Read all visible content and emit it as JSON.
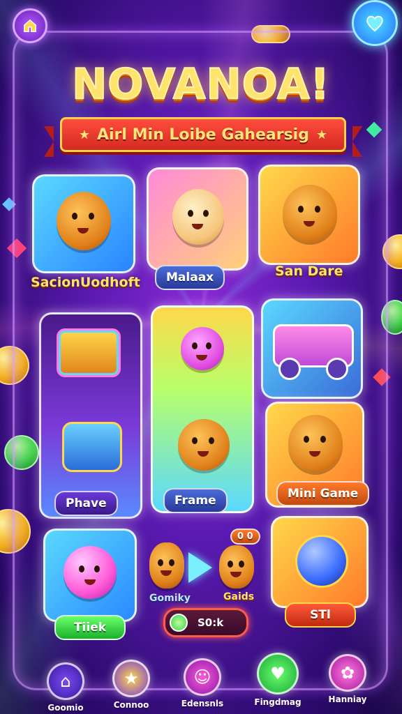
{
  "header": {
    "title": "NOVANOA!",
    "subtitle": "Airl Min Loibe Gahearsig"
  },
  "cards": [
    {
      "label": "SacionUodhoft"
    },
    {
      "label": "Malaax"
    },
    {
      "label": "San Dare"
    },
    {
      "label": "Phave"
    },
    {
      "label": "Frame"
    },
    {
      "label": "Mini Game"
    },
    {
      "label": "Tiiek"
    },
    {
      "label": "STl"
    }
  ],
  "center_bottom": {
    "left_label": "Gomiky",
    "right_label": "Gaids",
    "counter_value": "S0:k",
    "badge_value": "0 0"
  },
  "nav": {
    "items": [
      {
        "label": "Goomio",
        "icon": "house-icon"
      },
      {
        "label": "Connoo",
        "icon": "star-icon"
      },
      {
        "label": "Edensnls",
        "icon": "monster-icon"
      },
      {
        "label": "Fingdmag",
        "icon": "heart-icon"
      },
      {
        "label": "Hanniay",
        "icon": "creature-icon"
      }
    ]
  },
  "colors": {
    "background": "#5a1ab0",
    "title": "#ffe36a",
    "ribbon": "#d32a22"
  }
}
